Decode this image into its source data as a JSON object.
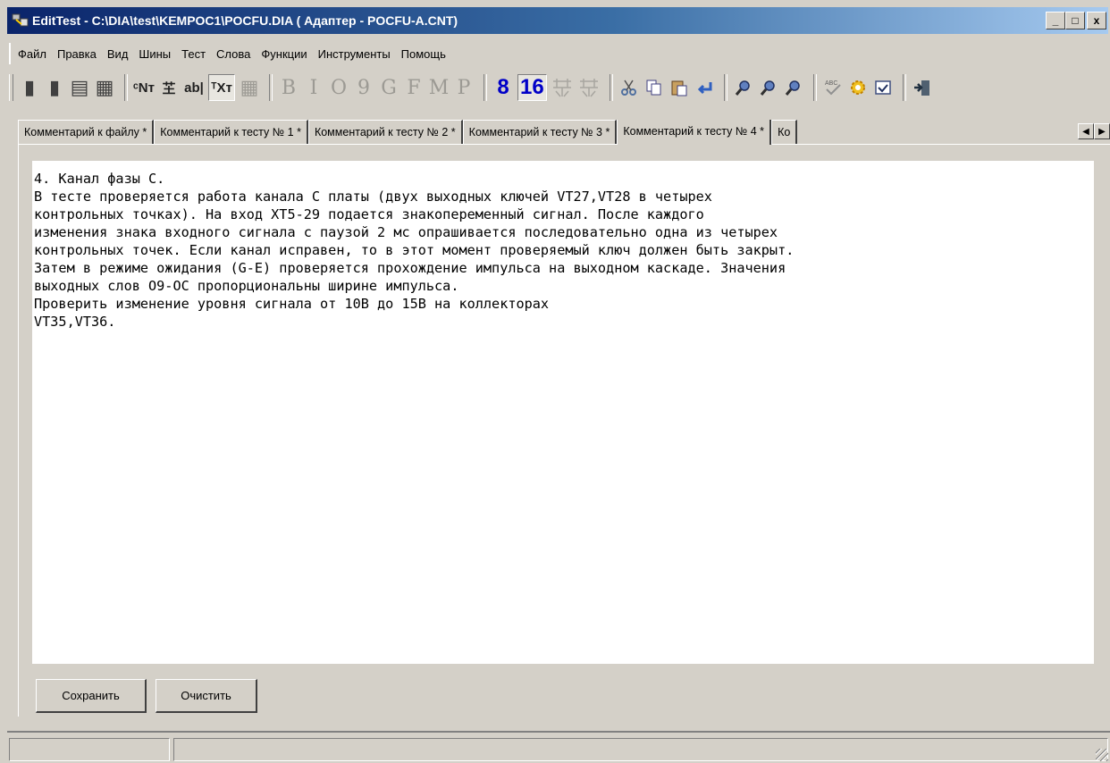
{
  "window": {
    "title": "EditTest - C:\\DIA\\test\\KEMPOC1\\POCFU.DIA ( Адаптер - POCFU-A.CNT)",
    "minimize_label": "_",
    "maximize_label": "□",
    "close_label": "x"
  },
  "menu": {
    "items": [
      {
        "label": "Файл"
      },
      {
        "label": "Правка"
      },
      {
        "label": "Вид"
      },
      {
        "label": "Шины"
      },
      {
        "label": "Тест"
      },
      {
        "label": "Слова"
      },
      {
        "label": "Функции"
      },
      {
        "label": "Инструменты"
      },
      {
        "label": "Помощь"
      }
    ]
  },
  "toolbar": {
    "buttons": [
      {
        "name": "new-file-icon",
        "glyph": "▮"
      },
      {
        "name": "open-folder-icon",
        "glyph": "▮"
      },
      {
        "name": "save-disk-icon",
        "glyph": "▤"
      },
      {
        "name": "print-preview-icon",
        "glyph": "▦"
      },
      {
        "name": "nt-symbol-icon",
        "glyph": "ᶜNᴛ"
      },
      {
        "name": "circuit-icon",
        "glyph": "芏"
      },
      {
        "name": "ab-text-icon",
        "glyph": "ab|"
      },
      {
        "name": "tx-format-icon",
        "glyph": "ᵀXᴛ"
      },
      {
        "name": "grid-table-icon",
        "glyph": "▦"
      },
      {
        "name": "bold-b-icon",
        "glyph": "B"
      },
      {
        "name": "italic-i-icon",
        "glyph": "I"
      },
      {
        "name": "circle-o-icon",
        "glyph": "O"
      },
      {
        "name": "nine-icon",
        "glyph": "9"
      },
      {
        "name": "letter-g-icon",
        "glyph": "G"
      },
      {
        "name": "letter-f-icon",
        "glyph": "F"
      },
      {
        "name": "letter-m-icon",
        "glyph": "M"
      },
      {
        "name": "letter-p-icon",
        "glyph": "P"
      },
      {
        "name": "base-8-icon",
        "glyph": "8"
      },
      {
        "name": "base-16-icon",
        "glyph": "16"
      }
    ],
    "right_icons": [
      "cut-icon",
      "copy-icon",
      "paste-icon",
      "undo-arrow-icon",
      "find-icon",
      "find-next-icon",
      "replace-icon",
      "spellcheck-icon",
      "settings-gear-icon",
      "checkbox-icon",
      "exit-door-icon"
    ]
  },
  "tabs": [
    {
      "label": "Комментарий к файлу *"
    },
    {
      "label": "Комментарий к тесту № 1 *"
    },
    {
      "label": "Комментарий к тесту № 2 *"
    },
    {
      "label": "Комментарий к тесту № 3 *"
    },
    {
      "label": "Комментарий к тесту № 4 *",
      "active": true
    },
    {
      "label": "Ко"
    }
  ],
  "tab_scroll": {
    "left": "◀",
    "right": "▶"
  },
  "editor": {
    "lines": [
      "4. Канал фазы С.",
      "В тесте проверяется работа канала С платы (двух выходных ключей VT27,VT28 в четырех",
      "контрольных точках). На вход ХТ5-29 подается знакопеременный сигнал. После каждого",
      "изменения знака входного сигнала с паузой 2 мс опрашивается последовательно одна из четырех",
      "контрольных точек. Если канал исправен, то в этот момент проверяемый ключ должен быть закрыт.",
      "Затем в режиме ожидания (G-E) проверяется прохождение импульса на выходном каскаде. Значения",
      "выходных слов О9-ОС пропорциональны ширине импульса.",
      "Проверить изменение уровня сигнала от 10В до 15В на коллекторах",
      "VT35,VT36."
    ]
  },
  "buttons": {
    "save_label": "Сохранить",
    "clear_label": "Очистить"
  }
}
